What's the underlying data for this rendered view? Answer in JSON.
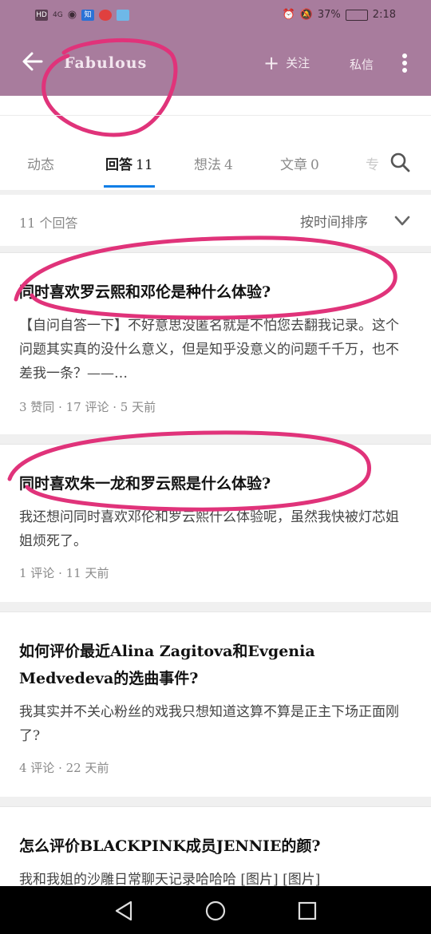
{
  "status_bar": {
    "left_icons": [
      "hd-icon",
      "signal-icon",
      "eye-icon",
      "zhihu-app-icon",
      "weibo-app-icon",
      "browser-app-icon"
    ],
    "left_text": {
      "hd": "HD",
      "net": "4G",
      "zhihu": "知"
    },
    "battery": "37%",
    "time": "2:18"
  },
  "header": {
    "title": "Fabulous",
    "follow_label": "关注",
    "message_label": "私信",
    "bg_color": "#a87c9d"
  },
  "tabs": [
    {
      "label": "动态",
      "count": ""
    },
    {
      "label": "回答",
      "count": "11"
    },
    {
      "label": "想法",
      "count": "4"
    },
    {
      "label": "文章",
      "count": "0"
    },
    {
      "label": "专",
      "count": ""
    }
  ],
  "sort_bar": {
    "count_label": "11 个回答",
    "sort_label": "按时间排序"
  },
  "answers": [
    {
      "question": "同时喜欢罗云熙和邓伦是种什么体验?",
      "excerpt": "【自问自答一下】不好意思没匿名就是不怕您去翻我记录。这个问题其实真的没什么意义，但是知乎没意义的问题千千万，也不差我一条？——…",
      "meta": "3 赞同 · 17 评论 · 5 天前"
    },
    {
      "question": "同时喜欢朱一龙和罗云熙是什么体验?",
      "excerpt": "我还想问同时喜欢邓伦和罗云熙什么体验呢，虽然我快被灯芯姐姐烦死了。",
      "meta": "1 评论 · 11 天前"
    },
    {
      "question": "如何评价最近Alina Zagitova和Evgenia Medvedeva的选曲事件?",
      "excerpt": "我其实并不关心粉丝的戏我只想知道这算不算是正主下场正面刚了?",
      "meta": "4 评论 · 22 天前"
    },
    {
      "question": "怎么评价BLACKPINK成员JENNIE的颜?",
      "excerpt": "我和我姐的沙雕日常聊天记录哈哈哈 [图片] [图片]",
      "meta": ""
    }
  ],
  "colors": {
    "accent": "#0e7ee6",
    "annotation": "#e0337a"
  }
}
